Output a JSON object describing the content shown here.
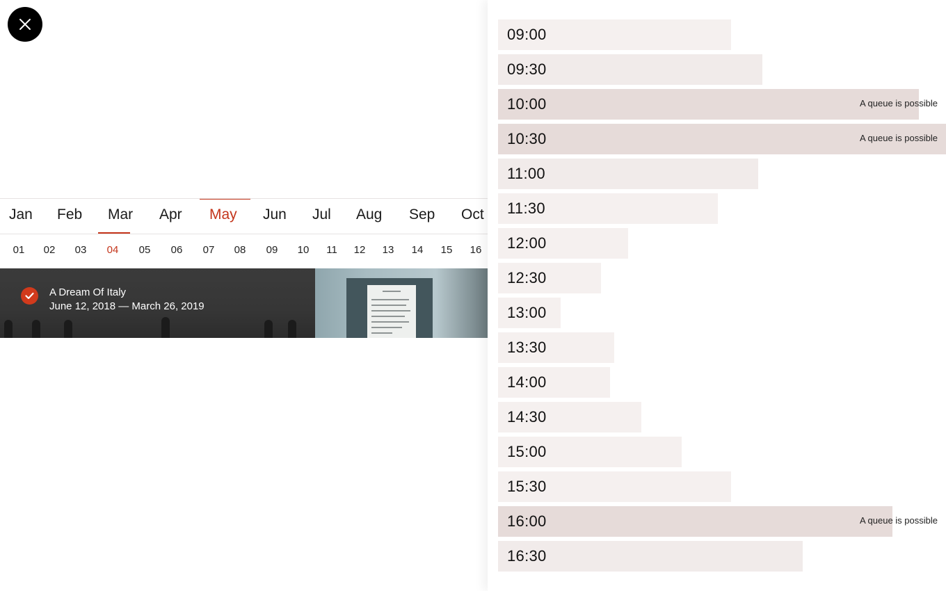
{
  "close_icon": "close-x-icon",
  "months": [
    {
      "label": "Jan"
    },
    {
      "label": "Feb"
    },
    {
      "label": "Mar"
    },
    {
      "label": "Apr"
    },
    {
      "label": "May"
    },
    {
      "label": "Jun"
    },
    {
      "label": "Jul"
    },
    {
      "label": "Aug"
    },
    {
      "label": "Sep"
    },
    {
      "label": "Oct"
    }
  ],
  "active_month": "May",
  "days": [
    "01",
    "02",
    "03",
    "04",
    "05",
    "06",
    "07",
    "08",
    "09",
    "10",
    "11",
    "12",
    "13",
    "14",
    "15",
    "16"
  ],
  "active_day": "04",
  "exhibition": {
    "title": "A Dream Of Italy",
    "dates": "June 12, 2018 — March 26, 2019",
    "selected_icon": "checkmark-icon"
  },
  "colors": {
    "accent": "#c4351b",
    "slot_low": "#f5f0ef",
    "slot_mid": "#f1ebea",
    "slot_high": "#e6dbd9"
  },
  "time_slots": [
    {
      "time": "09:00",
      "load": 0.52,
      "queue": ""
    },
    {
      "time": "09:30",
      "load": 0.59,
      "queue": ""
    },
    {
      "time": "10:00",
      "load": 0.94,
      "queue": "A queue is possible"
    },
    {
      "time": "10:30",
      "load": 1.0,
      "queue": "A queue is possible"
    },
    {
      "time": "11:00",
      "load": 0.58,
      "queue": ""
    },
    {
      "time": "11:30",
      "load": 0.49,
      "queue": ""
    },
    {
      "time": "12:00",
      "load": 0.29,
      "queue": ""
    },
    {
      "time": "12:30",
      "load": 0.23,
      "queue": ""
    },
    {
      "time": "13:00",
      "load": 0.14,
      "queue": ""
    },
    {
      "time": "13:30",
      "load": 0.26,
      "queue": ""
    },
    {
      "time": "14:00",
      "load": 0.25,
      "queue": ""
    },
    {
      "time": "14:30",
      "load": 0.32,
      "queue": ""
    },
    {
      "time": "15:00",
      "load": 0.41,
      "queue": ""
    },
    {
      "time": "15:30",
      "load": 0.52,
      "queue": ""
    },
    {
      "time": "16:00",
      "load": 0.88,
      "queue": "A queue is possible"
    },
    {
      "time": "16:30",
      "load": 0.68,
      "queue": ""
    }
  ]
}
